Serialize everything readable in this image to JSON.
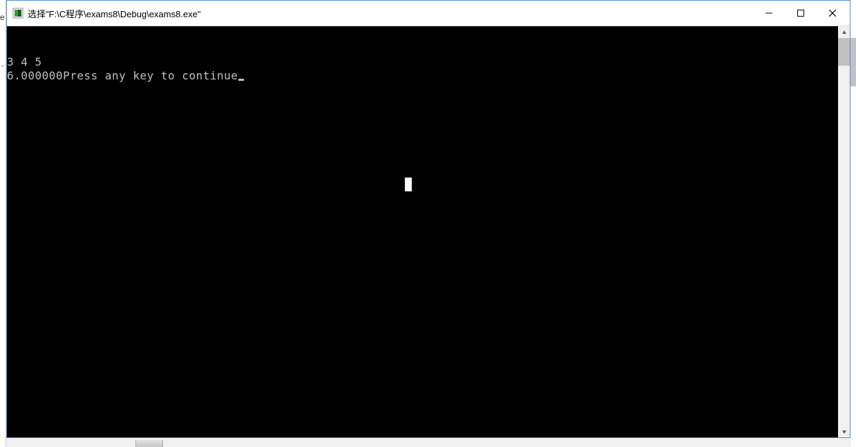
{
  "window": {
    "title": "选择\"F:\\C程序\\exams8\\Debug\\exams8.exe\""
  },
  "console": {
    "line1": "3 4 5",
    "line2": "6.000000Press any key to continue"
  },
  "icons": {
    "app": "console-app-icon",
    "minimize": "minimize-icon",
    "maximize": "maximize-icon",
    "close": "close-icon",
    "scrollUp": "scroll-up-icon",
    "scrollDown": "scroll-down-icon"
  }
}
